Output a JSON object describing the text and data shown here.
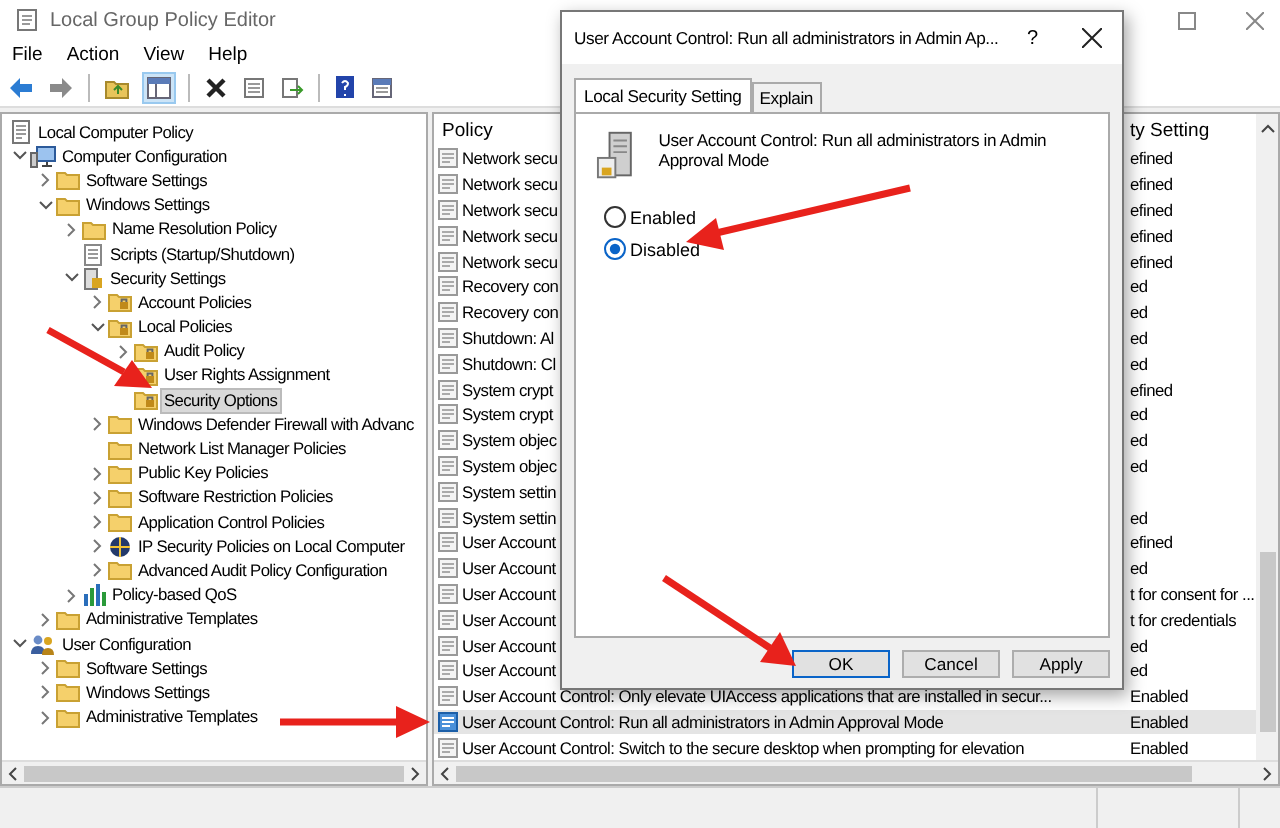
{
  "window": {
    "title": "Local Group Policy Editor"
  },
  "menu": [
    "File",
    "Action",
    "View",
    "Help"
  ],
  "tree": [
    {
      "label": "Local Computer Policy",
      "kind": "root",
      "selected": false,
      "children": [
        {
          "label": "Computer Configuration",
          "kind": "computer",
          "expanded": true,
          "selected": false,
          "children": [
            {
              "label": "Software Settings",
              "kind": "folder",
              "expanded": false,
              "selected": false
            },
            {
              "label": "Windows Settings",
              "kind": "folder",
              "expanded": true,
              "selected": false,
              "children": [
                {
                  "label": "Name Resolution Policy",
                  "kind": "folder",
                  "expanded": false,
                  "selected": false
                },
                {
                  "label": "Scripts (Startup/Shutdown)",
                  "kind": "document",
                  "selected": false
                },
                {
                  "label": "Security Settings",
                  "kind": "security",
                  "expanded": true,
                  "selected": false,
                  "children": [
                    {
                      "label": "Account Policies",
                      "kind": "policy-folder",
                      "expanded": false,
                      "selected": false
                    },
                    {
                      "label": "Local Policies",
                      "kind": "policy-folder",
                      "expanded": true,
                      "selected": false,
                      "children": [
                        {
                          "label": "Audit Policy",
                          "kind": "policy-folder",
                          "expanded": false,
                          "selected": false
                        },
                        {
                          "label": "User Rights Assignment",
                          "kind": "policy-folder",
                          "selected": false
                        },
                        {
                          "label": "Security Options",
                          "kind": "policy-folder",
                          "selected": true
                        }
                      ]
                    },
                    {
                      "label": "Windows Defender Firewall with Advanc",
                      "kind": "folder",
                      "expanded": false,
                      "selected": false
                    },
                    {
                      "label": "Network List Manager Policies",
                      "kind": "folder",
                      "selected": false
                    },
                    {
                      "label": "Public Key Policies",
                      "kind": "folder",
                      "expanded": false,
                      "selected": false
                    },
                    {
                      "label": "Software Restriction Policies",
                      "kind": "folder",
                      "expanded": false,
                      "selected": false
                    },
                    {
                      "label": "Application Control Policies",
                      "kind": "folder",
                      "expanded": false,
                      "selected": false
                    },
                    {
                      "label": "IP Security Policies on Local Computer",
                      "kind": "network",
                      "expanded": false,
                      "selected": false
                    },
                    {
                      "label": "Advanced Audit Policy Configuration",
                      "kind": "folder",
                      "expanded": false,
                      "selected": false
                    }
                  ]
                },
                {
                  "label": "Policy-based QoS",
                  "kind": "chart",
                  "expanded": false,
                  "selected": false
                }
              ]
            },
            {
              "label": "Administrative Templates",
              "kind": "folder",
              "expanded": false,
              "selected": false
            }
          ]
        },
        {
          "label": "User Configuration",
          "kind": "users",
          "expanded": true,
          "selected": false,
          "children": [
            {
              "label": "Software Settings",
              "kind": "folder",
              "expanded": false,
              "selected": false
            },
            {
              "label": "Windows Settings",
              "kind": "folder",
              "expanded": false,
              "selected": false
            },
            {
              "label": "Administrative Templates",
              "kind": "folder",
              "expanded": false,
              "selected": false
            }
          ]
        }
      ]
    }
  ],
  "policy_list": {
    "columns": [
      "Policy",
      "ty Setting"
    ],
    "rows": [
      {
        "policy": "Network secu",
        "setting": "efined",
        "selected": false
      },
      {
        "policy": "Network secu",
        "setting": "efined",
        "selected": false
      },
      {
        "policy": "Network secu",
        "setting": "efined",
        "selected": false
      },
      {
        "policy": "Network secu",
        "setting": "efined",
        "selected": false
      },
      {
        "policy": "Network secu",
        "setting": "efined",
        "selected": false
      },
      {
        "policy": "Recovery con",
        "setting": "ed",
        "selected": false
      },
      {
        "policy": "Recovery con",
        "setting": "ed",
        "selected": false
      },
      {
        "policy": "Shutdown: Al",
        "setting": "ed",
        "selected": false
      },
      {
        "policy": "Shutdown: Cl",
        "setting": "ed",
        "selected": false
      },
      {
        "policy": "System crypt",
        "setting": "efined",
        "selected": false
      },
      {
        "policy": "System crypt",
        "setting": "ed",
        "selected": false
      },
      {
        "policy": "System objec",
        "setting": "ed",
        "selected": false
      },
      {
        "policy": "System objec",
        "setting": "ed",
        "selected": false
      },
      {
        "policy": "System settin",
        "selected": false
      },
      {
        "policy": "System settin",
        "setting": "ed",
        "selected": false
      },
      {
        "policy": "User Account",
        "setting": "efined",
        "selected": false
      },
      {
        "policy": "User Account",
        "setting": "ed",
        "selected": false
      },
      {
        "policy": "User Account",
        "setting": "t for consent for ...",
        "selected": false
      },
      {
        "policy": "User Account",
        "setting": "t for credentials",
        "selected": false
      },
      {
        "policy": "User Account",
        "setting": "ed",
        "selected": false
      },
      {
        "policy": "User Account",
        "setting": "ed",
        "selected": false
      },
      {
        "policy": "User Account Control: Only elevate UIAccess applications that are installed in secur...",
        "setting": "Enabled",
        "selected": false
      },
      {
        "policy": "User Account Control: Run all administrators in Admin Approval Mode",
        "setting": "Enabled",
        "selected": true
      },
      {
        "policy": "User Account Control: Switch to the secure desktop when prompting for elevation",
        "setting": "Enabled",
        "selected": false
      }
    ]
  },
  "dialog": {
    "title": "User Account Control: Run all administrators in Admin Ap...",
    "help": "?",
    "tabs": [
      {
        "label": "Local Security Setting",
        "selected": true
      },
      {
        "label": "Explain",
        "selected": false
      }
    ],
    "description": "User Account Control: Run all administrators in Admin Approval Mode",
    "options": [
      {
        "label": "Enabled",
        "selected": false
      },
      {
        "label": "Disabled",
        "selected": true
      }
    ],
    "buttons": [
      {
        "label": "OK",
        "default": true
      },
      {
        "label": "Cancel",
        "default": false
      },
      {
        "label": "Apply",
        "default": false
      }
    ]
  }
}
